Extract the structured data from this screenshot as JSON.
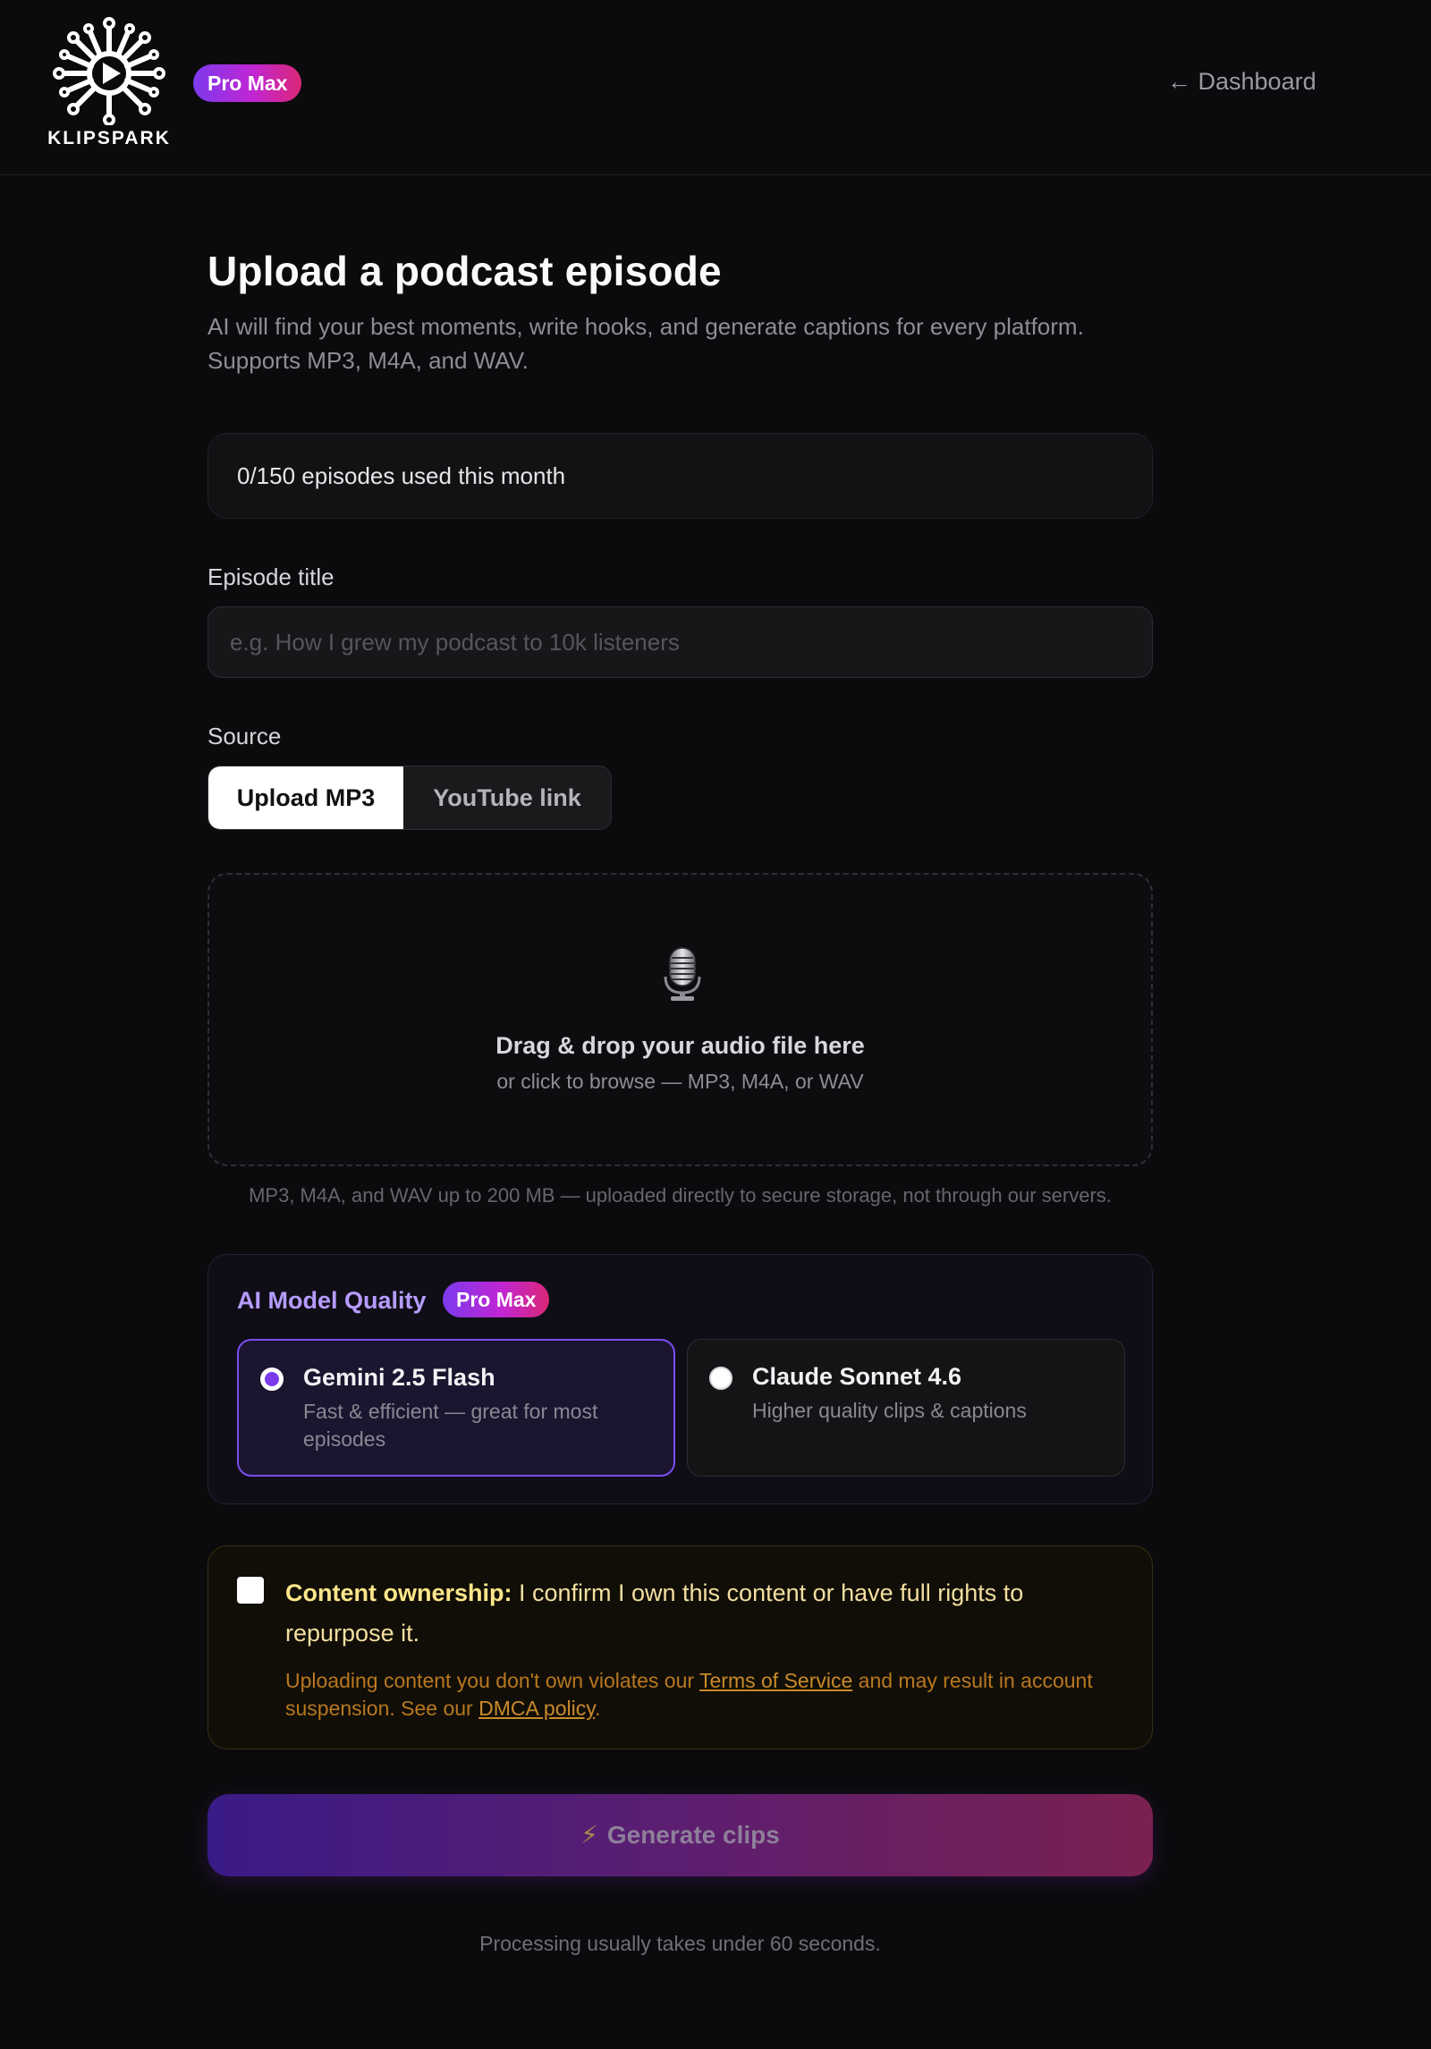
{
  "header": {
    "logo_text": "KLIPSPARK",
    "plan_badge": "Pro Max",
    "dashboard_link": "← Dashboard"
  },
  "page": {
    "title": "Upload a podcast episode",
    "subtitle": "AI will find your best moments, write hooks, and generate captions for every platform. Supports MP3, M4A, and WAV."
  },
  "usage": {
    "text": "0/150 episodes used this month"
  },
  "episode_title": {
    "label": "Episode title",
    "value": "",
    "placeholder": "e.g. How I grew my podcast to 10k listeners"
  },
  "source": {
    "label": "Source",
    "options": [
      "Upload MP3",
      "YouTube link"
    ],
    "selected": "Upload MP3"
  },
  "dropzone": {
    "icon": "microphone-icon",
    "title": "Drag & drop your audio file here",
    "subtitle": "or click to browse — MP3, M4A, or WAV",
    "note": "MP3, M4A, and WAV up to 200 MB — uploaded directly to secure storage, not through our servers."
  },
  "model": {
    "heading": "AI Model Quality",
    "badge": "Pro Max",
    "options": [
      {
        "name": "Gemini 2.5 Flash",
        "description": "Fast & efficient — great for most episodes",
        "selected": true
      },
      {
        "name": "Claude Sonnet 4.6",
        "description": "Higher quality clips & captions",
        "selected": false
      }
    ]
  },
  "ownership": {
    "checked": false,
    "label_bold": "Content ownership:",
    "label_rest": " I confirm I own this content or have full rights to repurpose it.",
    "warning_part1": "Uploading content you don't own violates our ",
    "terms_link": "Terms of Service",
    "warning_part2": " and may result in account suspension. See our ",
    "dmca_link": "DMCA policy",
    "warning_part3": "."
  },
  "generate": {
    "icon": "lightning-icon",
    "bolt": "⚡",
    "label": "Generate clips",
    "note": "Processing usually takes under 60 seconds."
  },
  "colors": {
    "background": "#0b0b0d",
    "accent_purple": "#7c3aed",
    "accent_pink": "#db2777",
    "model_heading": "#b69cff",
    "ownership_text": "#fde68a",
    "ownership_warning": "#b8781f"
  }
}
